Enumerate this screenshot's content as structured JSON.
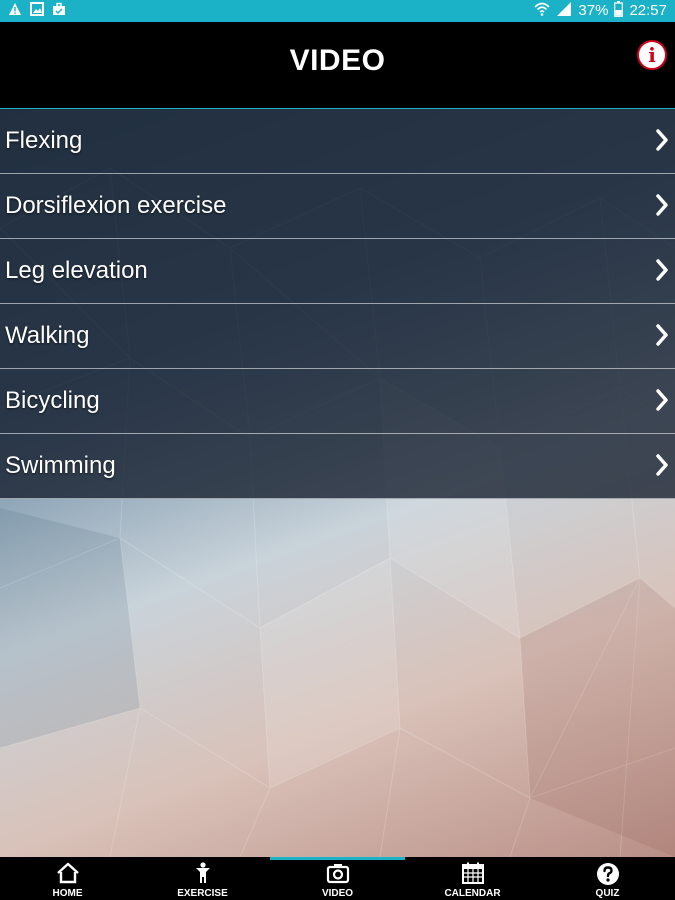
{
  "status_bar": {
    "battery": "37%",
    "time": "22:57"
  },
  "header": {
    "title": "VIDEO",
    "info_glyph": "i"
  },
  "videos": [
    {
      "label": "Flexing"
    },
    {
      "label": "Dorsiflexion exercise"
    },
    {
      "label": "Leg elevation"
    },
    {
      "label": "Walking"
    },
    {
      "label": "Bicycling"
    },
    {
      "label": "Swimming"
    }
  ],
  "nav": {
    "home": "HOME",
    "exercise": "EXERCISE",
    "video": "VIDEO",
    "calendar": "CALENDAR",
    "quiz": "QUIZ",
    "active": "video"
  },
  "colors": {
    "accent": "#1bb1c6",
    "info_red": "#d0021b"
  },
  "icons": {
    "status_left": [
      "warning-icon",
      "image-icon",
      "briefcase-icon"
    ],
    "status_right": [
      "wifi-icon",
      "signal-icon",
      "battery-icon"
    ],
    "nav": [
      "home-icon",
      "person-icon",
      "camera-icon",
      "calendar-icon",
      "question-icon"
    ]
  }
}
